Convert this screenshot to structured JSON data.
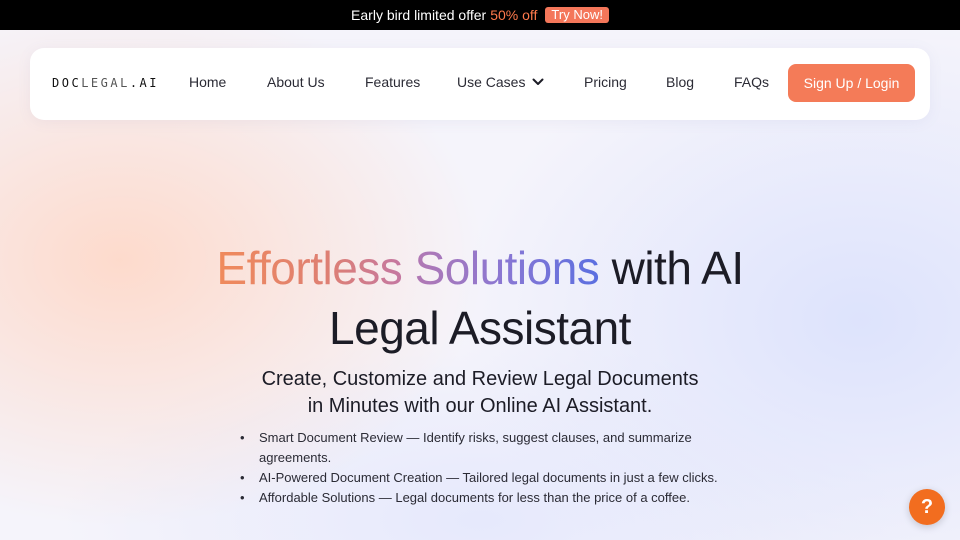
{
  "promo": {
    "text": "Early bird limited offer",
    "offer": "50% off",
    "cta": "Try Now!"
  },
  "nav": {
    "logo": {
      "part1": "DOC",
      "part2": "LEGAL",
      "part3": ".AI"
    },
    "items": [
      {
        "label": "Home"
      },
      {
        "label": "About Us"
      },
      {
        "label": "Features"
      },
      {
        "label": "Use Cases",
        "icon": "chevron-down-icon"
      },
      {
        "label": "Pricing"
      },
      {
        "label": "Blog"
      },
      {
        "label": "FAQs"
      }
    ],
    "signup": "Sign Up / Login"
  },
  "hero": {
    "title_part1": "Effortless",
    "title_part2": "Solutions",
    "title_part3": "with AI",
    "title_line2": "Legal Assistant",
    "subtitle_line1": "Create, Customize and Review Legal Documents",
    "subtitle_line2": "in Minutes with our Online AI Assistant.",
    "bullets": [
      "Smart Document Review — Identify risks, suggest clauses, and summarize agreements.",
      "AI-Powered Document Creation — Tailored legal documents in just a few clicks.",
      "Affordable Solutions — Legal documents for less than the price of a coffee."
    ]
  },
  "help": {
    "label": "?",
    "icon": "help-icon"
  },
  "colors": {
    "accent": "#f47b58",
    "help": "#f26d1f",
    "promo_bg": "#000000"
  }
}
